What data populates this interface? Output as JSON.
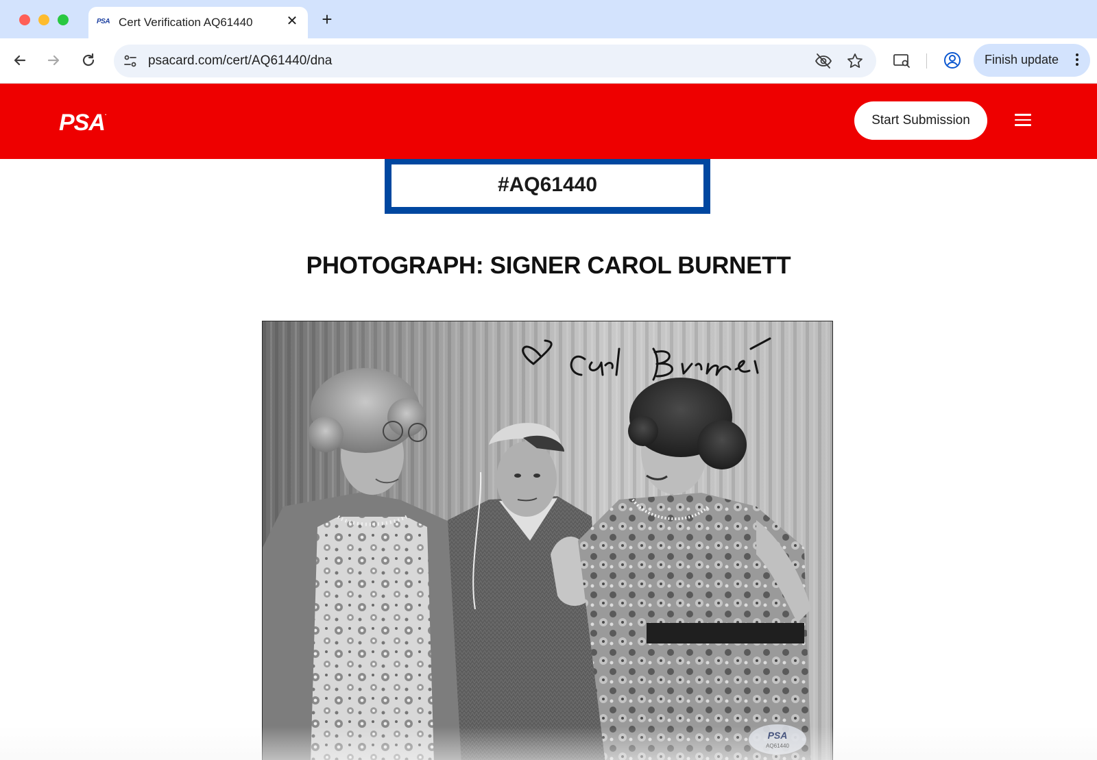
{
  "browser": {
    "tab": {
      "favicon_text": "PSA",
      "title": "Cert Verification AQ61440",
      "close_glyph": "✕"
    },
    "new_tab_glyph": "+",
    "url": "psacard.com/cert/AQ61440/dna",
    "finish_update_label": "Finish update",
    "icons": [
      "back-arrow-icon",
      "forward-arrow-icon",
      "reload-icon",
      "site-info-icon",
      "eye-off-icon",
      "star-icon",
      "cast-search-icon",
      "profile-icon",
      "kebab-menu-icon"
    ]
  },
  "site": {
    "logo_text": "PSA",
    "logo_mark": ".",
    "start_submission_label": "Start Submission",
    "cert_number": "#AQ61440",
    "item_title": "PHOTOGRAPH: SIGNER CAROL BURNETT",
    "photo": {
      "signature_text": "Carol Burnett",
      "sticker_logo": "PSA",
      "sticker_cert": "AQ61440"
    }
  },
  "colors": {
    "psa_red": "#ee0000",
    "cert_border_blue": "#0047a0",
    "tabstrip": "#d3e3fd",
    "omnibox": "#edf2fa"
  }
}
